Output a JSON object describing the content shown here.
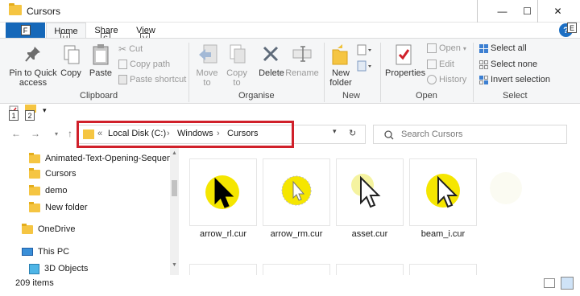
{
  "window": {
    "title": "Cursors",
    "minimize_glyph": "—",
    "maximize_glyph": "☐",
    "close_glyph": "✕"
  },
  "ribbon_tabs": {
    "file": {
      "label": "F"
    },
    "home": {
      "label": "Home",
      "keytip": "H"
    },
    "share": {
      "label": "Share",
      "keytip": "S"
    },
    "view": {
      "label": "View",
      "keytip": "V"
    },
    "help_glyph": "?",
    "help_keytip": "E"
  },
  "clipboard": {
    "pin_label": "Pin to Quick access",
    "copy_label": "Copy",
    "paste_label": "Paste",
    "cut_label": "Cut",
    "copy_path_label": "Copy path",
    "paste_shortcut_label": "Paste shortcut",
    "group_label": "Clipboard"
  },
  "organise": {
    "move_to_label": "Move to",
    "copy_to_label": "Copy to",
    "delete_label": "Delete",
    "rename_label": "Rename",
    "group_label": "Organise"
  },
  "new_group": {
    "new_folder_label": "New folder",
    "group_label": "New"
  },
  "open_group": {
    "properties_label": "Properties",
    "open_label": "Open",
    "edit_label": "Edit",
    "history_label": "History",
    "group_label": "Open"
  },
  "select_group": {
    "select_all_label": "Select all",
    "select_none_label": "Select none",
    "invert_label": "Invert selection",
    "group_label": "Select"
  },
  "quick_access": {
    "keytip_1": "1",
    "keytip_2": "2"
  },
  "address": {
    "overflow": "«",
    "crumbs": [
      "Local Disk (C:)",
      "Windows",
      "Cursors"
    ],
    "separator": "›",
    "refresh_glyph": "↻"
  },
  "search": {
    "placeholder": "Search Cursors"
  },
  "nav": {
    "items": [
      "Animated-Text-Opening-Sequence",
      "Cursors",
      "demo",
      "New folder"
    ],
    "onedrive": "OneDrive",
    "this_pc": "This PC",
    "objects_3d": "3D Objects"
  },
  "files": [
    {
      "name": "arrow_rl.cur"
    },
    {
      "name": "arrow_rm.cur"
    },
    {
      "name": "asset.cur"
    },
    {
      "name": "beam_i.cur"
    }
  ],
  "status": {
    "item_count": "209 items"
  },
  "colors": {
    "highlight": "#d0202a",
    "accent": "#1668b9",
    "cursor_yellow": "#f5e600"
  }
}
